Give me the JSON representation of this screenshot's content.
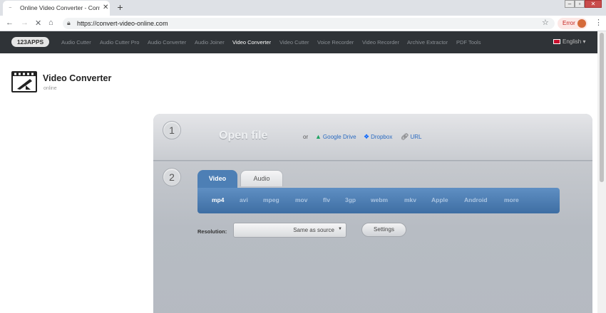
{
  "browser": {
    "tab_title": "Online Video Converter - Conve",
    "tab_close": "✕",
    "new_tab": "+",
    "url": "https://convert-video-online.com",
    "error_label": "Error"
  },
  "site_nav": {
    "logo": "123APPS",
    "items": [
      {
        "label": "Audio Cutter",
        "active": false
      },
      {
        "label": "Audio Cutter Pro",
        "active": false
      },
      {
        "label": "Audio Converter",
        "active": false
      },
      {
        "label": "Audio Joiner",
        "active": false
      },
      {
        "label": "Video Converter",
        "active": true
      },
      {
        "label": "Video Cutter",
        "active": false
      },
      {
        "label": "Voice Recorder",
        "active": false
      },
      {
        "label": "Video Recorder",
        "active": false
      },
      {
        "label": "Archive Extractor",
        "active": false
      },
      {
        "label": "PDF Tools",
        "active": false
      }
    ],
    "language": "English"
  },
  "header": {
    "title": "Video Converter",
    "subtitle": "online"
  },
  "step1": {
    "number": "1",
    "open_file": "Open file",
    "or": "or",
    "google_drive": "Google Drive",
    "dropbox": "Dropbox",
    "url": "URL"
  },
  "step2": {
    "number": "2",
    "tab_video": "Video",
    "tab_audio": "Audio",
    "formats": [
      "mp4",
      "avi",
      "mpeg",
      "mov",
      "flv",
      "3gp",
      "webm",
      "mkv",
      "Apple",
      "Android",
      "more"
    ],
    "selected_format": "mp4",
    "resolution_label": "Resolution:",
    "resolution_value": "Same as source",
    "settings_label": "Settings"
  },
  "colors": {
    "nav_bg": "#2f3337",
    "accent_blue": "#4d7fb5",
    "panel_gray": "#b6bbc2",
    "link_blue": "#2a6bc1"
  }
}
